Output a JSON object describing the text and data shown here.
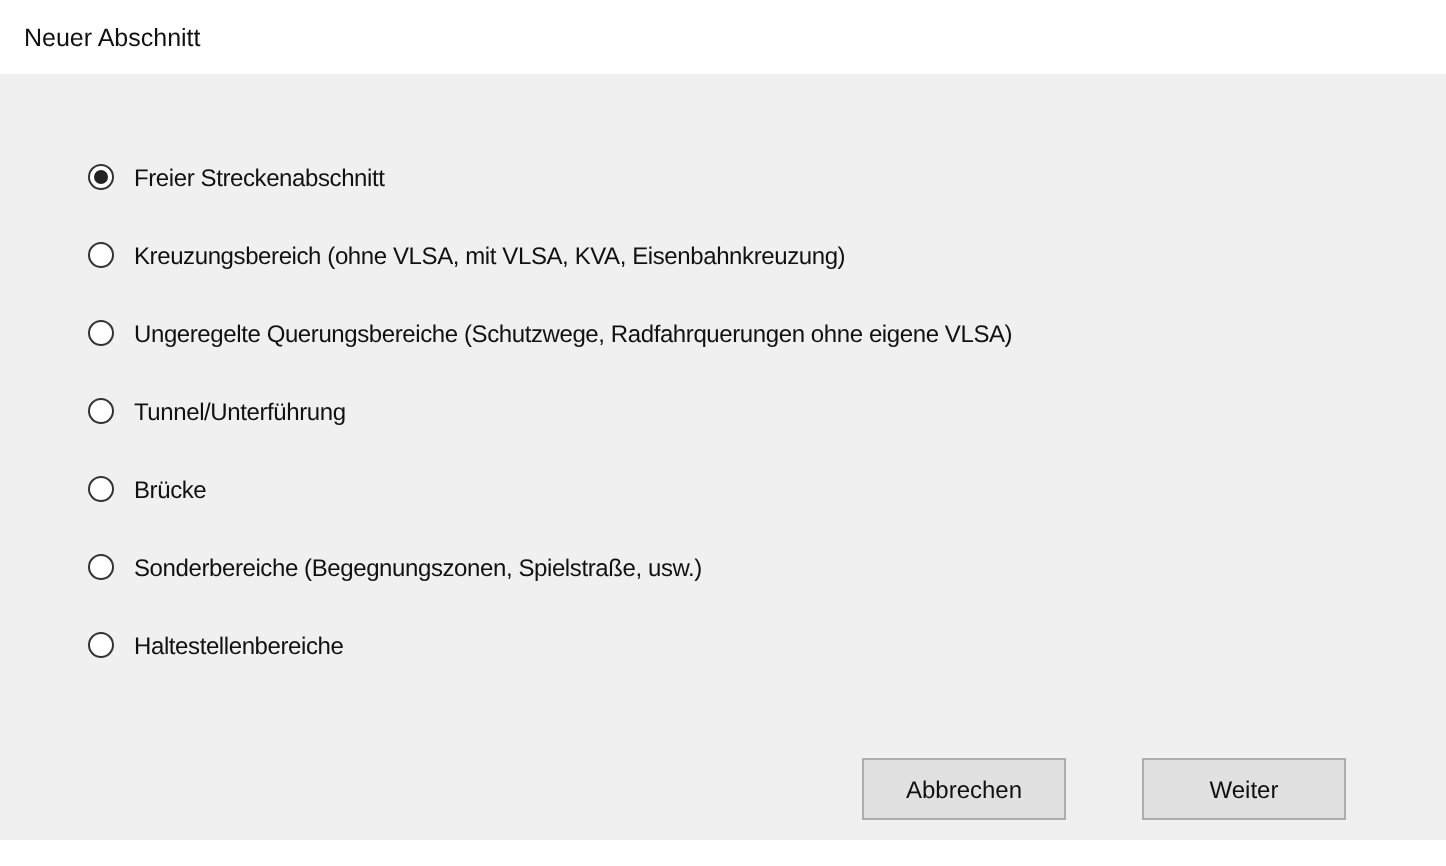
{
  "window": {
    "title": "Neuer Abschnitt"
  },
  "options": [
    {
      "label": "Freier Streckenabschnitt",
      "selected": true
    },
    {
      "label": "Kreuzungsbereich (ohne VLSA, mit VLSA, KVA, Eisenbahnkreuzung)",
      "selected": false
    },
    {
      "label": "Ungeregelte Querungsbereiche (Schutzwege, Radfahrquerungen ohne eigene VLSA)",
      "selected": false
    },
    {
      "label": "Tunnel/Unterführung",
      "selected": false
    },
    {
      "label": "Brücke",
      "selected": false
    },
    {
      "label": "Sonderbereiche (Begegnungszonen, Spielstraße, usw.)",
      "selected": false
    },
    {
      "label": "Haltestellenbereiche",
      "selected": false
    }
  ],
  "buttons": [
    "Abbrechen",
    "Weiter"
  ]
}
